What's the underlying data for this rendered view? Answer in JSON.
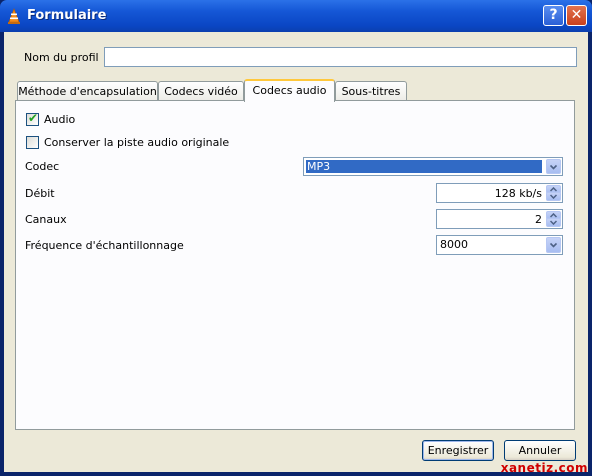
{
  "window": {
    "title": "Formulaire",
    "help_label": "?",
    "close_label": "✕"
  },
  "profile": {
    "label": "Nom du profil",
    "value": "",
    "placeholder": ""
  },
  "tabs": [
    {
      "label": "Méthode d'encapsulation",
      "active": false
    },
    {
      "label": "Codecs vidéo",
      "active": false
    },
    {
      "label": "Codecs audio",
      "active": true
    },
    {
      "label": "Sous-titres",
      "active": false
    }
  ],
  "audio": {
    "audio_checkbox": {
      "label": "Audio",
      "checked": true
    },
    "keep_original": {
      "label": "Conserver la piste audio originale",
      "checked": false
    },
    "codec": {
      "label": "Codec",
      "value": "MP3"
    },
    "bitrate": {
      "label": "Débit",
      "value": "128 kb/s"
    },
    "channels": {
      "label": "Canaux",
      "value": "2"
    },
    "samplerate": {
      "label": "Fréquence d'échantillonnage",
      "value": "8000"
    }
  },
  "buttons": {
    "save": "Enregistrer",
    "cancel": "Annuler"
  },
  "watermark": "xanetiz.com",
  "colors": {
    "titlebar": "#0a46c4",
    "selection": "#316ac5",
    "dialog_bg": "#ece9d8"
  }
}
